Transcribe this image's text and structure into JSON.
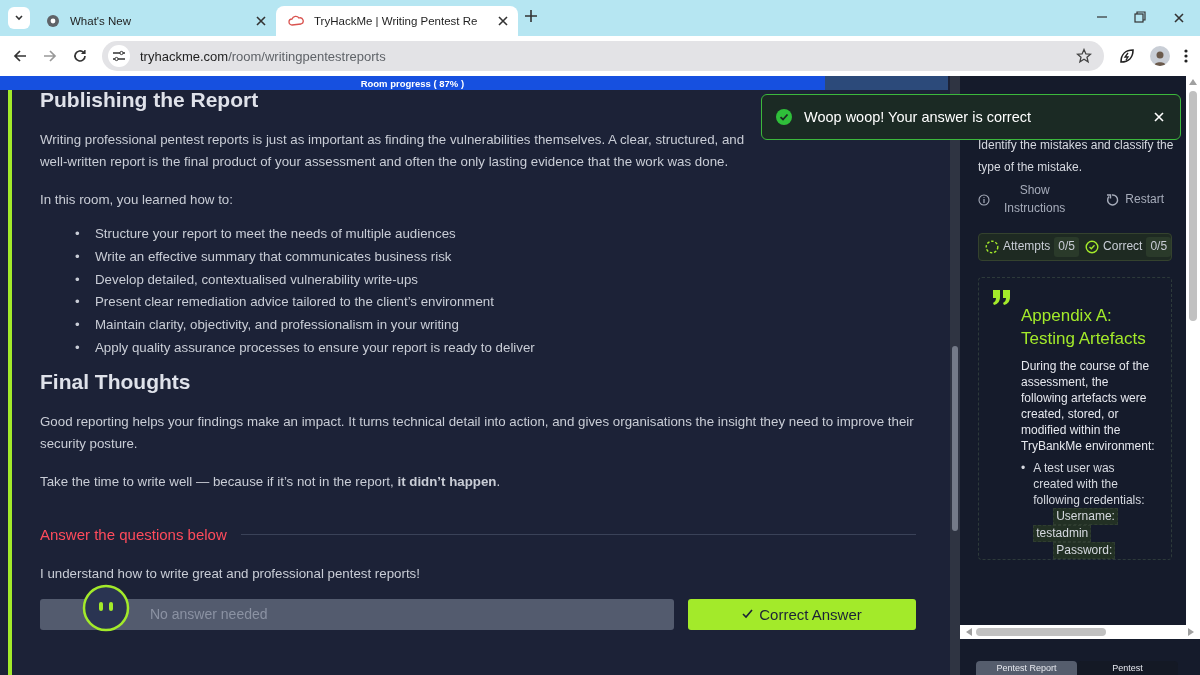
{
  "browser": {
    "tabs": [
      {
        "title": "What's New",
        "selected": false
      },
      {
        "title": "TryHackMe | Writing Pentest Re",
        "selected": true
      }
    ],
    "url": {
      "host": "tryhackme.com",
      "path": "/room/writingpentestreports"
    }
  },
  "progress": {
    "label": "Room progress ( 87% )",
    "level": 0.87
  },
  "content": [
    {
      "kind": "heading",
      "text": "Publishing the Report"
    },
    {
      "kind": "paragraph",
      "text": "Writing professional pentest reports is just as important as finding the vulnerabilities themselves. A clear, structured, and well-written report is the final product of your assessment and often the only lasting evidence that the work was done."
    },
    {
      "kind": "paragraph",
      "text": "In this room, you learned how to:"
    },
    {
      "kind": "list",
      "marker": "•",
      "items": [
        "Structure your report to meet the needs of multiple audiences",
        "Write an effective summary that communicates business risk",
        "Develop detailed, contextualised vulnerability write-ups",
        "Present clear remediation advice tailored to the client’s environment",
        "Maintain clarity, objectivity, and professionalism in your writing",
        "Apply quality assurance processes to ensure your report is ready to deliver"
      ]
    },
    {
      "kind": "heading",
      "text": "Final Thoughts"
    },
    {
      "kind": "paragraph",
      "text": "Good reporting helps your findings make an impact. It turns technical detail into action, and gives organisations the insight they need to improve their security posture."
    },
    {
      "kind": "paragraph",
      "text": "Take the time to write well — because if it’s not in the report, **it didn’t happen**."
    }
  ],
  "questions": {
    "title": "Answer the questions below",
    "question": "I understand how to write great and professional pentest reports!",
    "placeholder": "No answer needed",
    "button": "Correct Answer"
  },
  "toast": {
    "message": "Woop woop! Your answer is correct"
  },
  "sidebar": {
    "description": "Identify the mistakes and classify the type of the mistake.",
    "actions": [
      {
        "kind": "info",
        "label": "Show Instructions"
      },
      {
        "kind": "restart",
        "label": "Restart"
      }
    ],
    "stats": [
      {
        "kind": "attempts",
        "label": "Attempts",
        "value": "0/5"
      },
      {
        "kind": "correct",
        "label": "Correct",
        "value": "0/5"
      }
    ],
    "document": {
      "title": "Appendix A: Testing Artefacts",
      "intro": "During the course of the assessment, the following artefacts were created, stored, or modified within the TryBankMe environment:",
      "bullets": [
        {
          "marker": "•",
          "text": "A test user was created with the following credentials:",
          "credentials": [
            "Username:",
            "testadmin",
            "Password:"
          ]
        }
      ]
    },
    "tabs": [
      {
        "label": "Pentest Report",
        "selected": true
      },
      {
        "label": "Pentest",
        "selected": false
      }
    ]
  }
}
